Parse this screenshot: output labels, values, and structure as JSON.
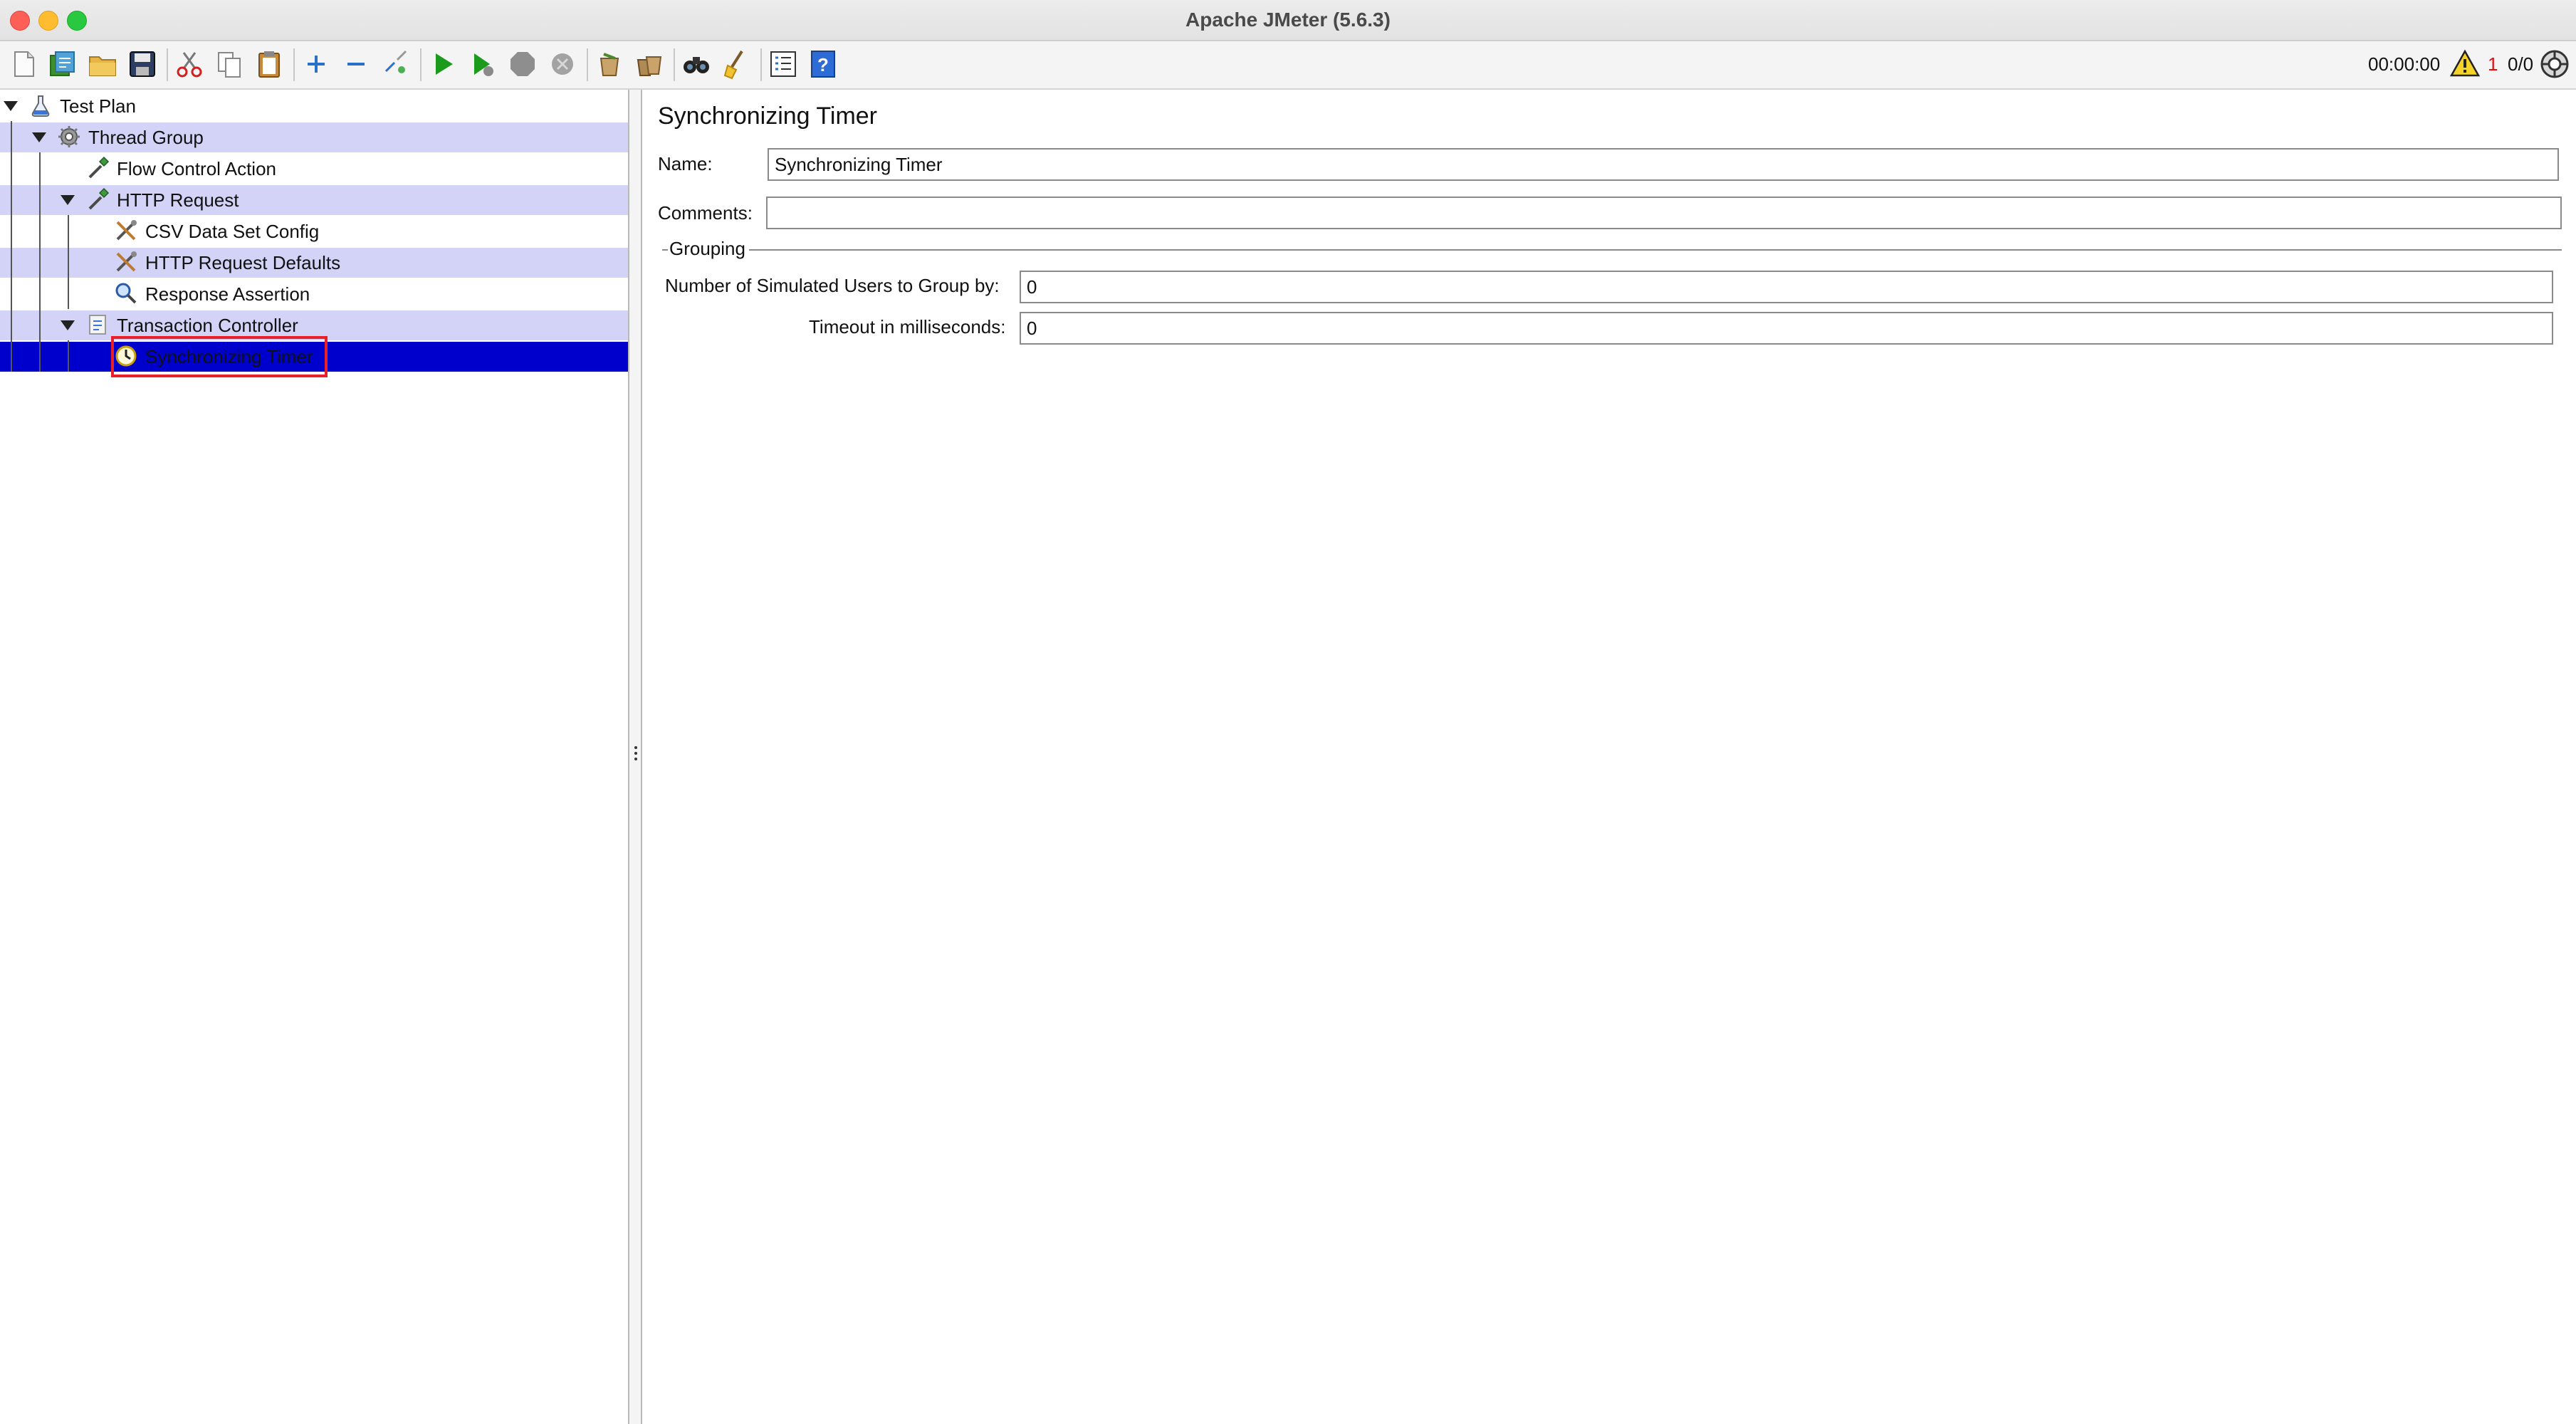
{
  "window": {
    "title": "Apache JMeter (5.6.3)"
  },
  "toolbar": {
    "buttons": [
      "new-icon",
      "templates-icon",
      "open-icon",
      "save-icon",
      "cut-icon",
      "copy-icon",
      "paste-icon",
      "expand-icon",
      "collapse-icon",
      "toggle-icon",
      "start-icon",
      "start-no-pauses-icon",
      "stop-icon",
      "shutdown-icon",
      "clear-icon",
      "clear-all-icon",
      "search-icon",
      "reset-search-icon",
      "function-helper-icon",
      "help-icon"
    ],
    "timer": "00:00:00",
    "warning_count": "1",
    "threads": "0/0"
  },
  "tree": {
    "items": [
      {
        "label": "Test Plan",
        "icon": "test-plan-icon"
      },
      {
        "label": "Thread Group",
        "icon": "gear-icon"
      },
      {
        "label": "Flow Control Action",
        "icon": "pipette-icon"
      },
      {
        "label": "HTTP Request",
        "icon": "pipette-icon"
      },
      {
        "label": "CSV Data Set Config",
        "icon": "tools-icon"
      },
      {
        "label": "HTTP Request Defaults",
        "icon": "tools-icon"
      },
      {
        "label": "Response Assertion",
        "icon": "magnifier-icon"
      },
      {
        "label": "Transaction Controller",
        "icon": "controller-icon"
      },
      {
        "label": "Synchronizing Timer",
        "icon": "timer-icon"
      }
    ],
    "selected": "Synchronizing Timer"
  },
  "panel": {
    "title": "Synchronizing Timer",
    "name_label": "Name:",
    "name_value": "Synchronizing Timer",
    "comments_label": "Comments:",
    "comments_value": "",
    "group_title": "Grouping",
    "users_label": "Number of Simulated Users to Group by:",
    "users_value": "0",
    "timeout_label": "Timeout in milliseconds:",
    "timeout_value": "0"
  },
  "colors": {
    "selection": "#0000cc",
    "row_highlight": "#d3d3f8",
    "annotation_box": "#e8202a"
  }
}
